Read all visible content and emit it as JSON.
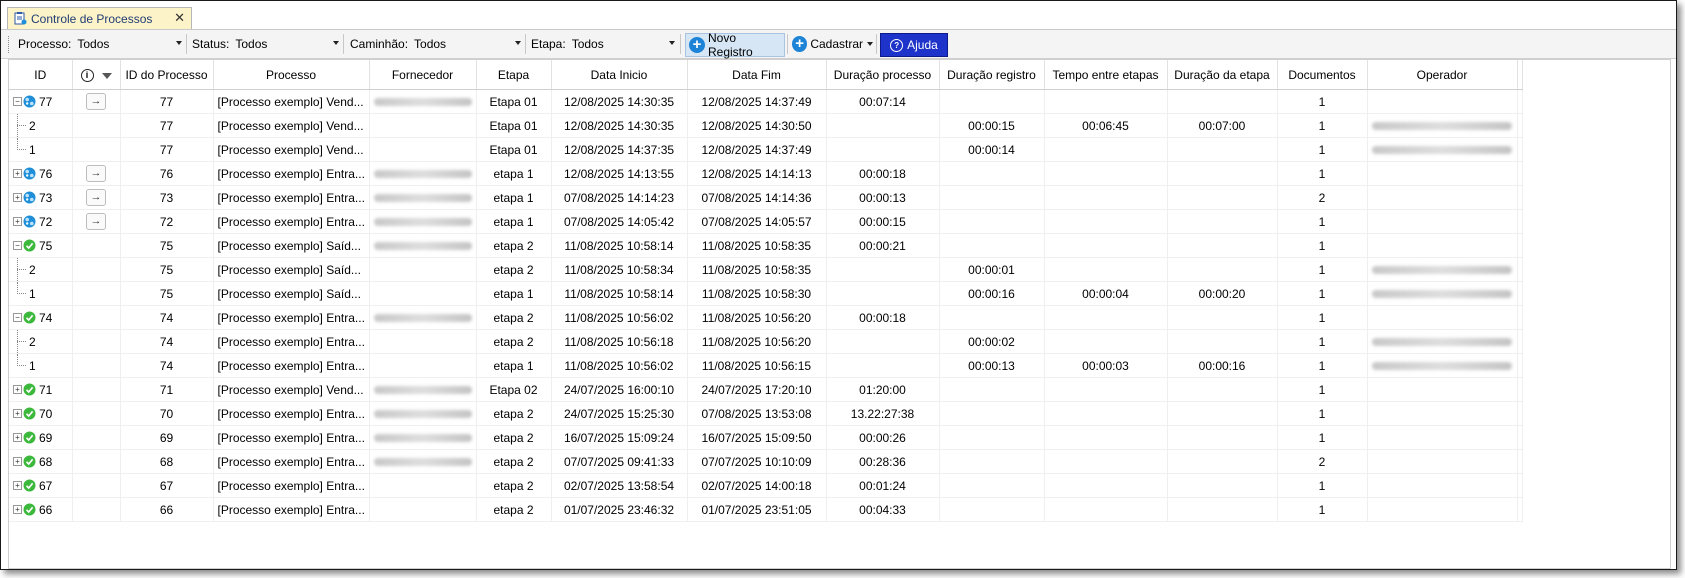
{
  "tab": {
    "label": "Controle de Processos",
    "close": "✕"
  },
  "toolbar": {
    "processo_label": "Processo:",
    "processo_value": "Todos",
    "status_label": "Status:",
    "status_value": "Todos",
    "caminhao_label": "Caminhão:",
    "caminhao_value": "Todos",
    "etapa_label": "Etapa:",
    "etapa_value": "Todos",
    "novo_label": "Novo Registro",
    "cadastrar_label": "Cadastrar",
    "ajuda_label": "Ajuda"
  },
  "columns": {
    "id": "ID",
    "id_processo": "ID do Processo",
    "processo": "Processo",
    "fornecedor": "Fornecedor",
    "etapa": "Etapa",
    "data_inicio": "Data Inicio",
    "data_fim": "Data Fim",
    "duracao_processo": "Duração processo",
    "duracao_registro": "Duração registro",
    "tempo_entre_etapas": "Tempo entre etapas",
    "duracao_etapa": "Duração da etapa",
    "documentos": "Documentos",
    "operador": "Operador"
  },
  "rows": [
    {
      "kind": "parent",
      "expanded": true,
      "status": "progress",
      "id": "77",
      "id_processo": "77",
      "processo": "[Processo exemplo] Vend...",
      "fornecedor_blur": true,
      "etapa": "Etapa 01",
      "data_inicio": "12/08/2025 14:30:35",
      "data_fim": "12/08/2025 14:37:49",
      "duracao_processo": "00:07:14",
      "duracao_registro": "",
      "tempo_entre_etapas": "",
      "duracao_etapa": "",
      "documentos": "1",
      "operador_blur": false,
      "arrow": true
    },
    {
      "kind": "child",
      "last": false,
      "id": "2",
      "id_processo": "77",
      "processo": "[Processo exemplo] Vend...",
      "fornecedor_blur": false,
      "etapa": "Etapa 01",
      "data_inicio": "12/08/2025 14:30:35",
      "data_fim": "12/08/2025 14:30:50",
      "duracao_processo": "",
      "duracao_registro": "00:00:15",
      "tempo_entre_etapas": "00:06:45",
      "duracao_etapa": "00:07:00",
      "documentos": "1",
      "operador_blur": true
    },
    {
      "kind": "child",
      "last": true,
      "id": "1",
      "id_processo": "77",
      "processo": "[Processo exemplo] Vend...",
      "fornecedor_blur": false,
      "etapa": "Etapa 01",
      "data_inicio": "12/08/2025 14:37:35",
      "data_fim": "12/08/2025 14:37:49",
      "duracao_processo": "",
      "duracao_registro": "00:00:14",
      "tempo_entre_etapas": "",
      "duracao_etapa": "",
      "documentos": "1",
      "operador_blur": true
    },
    {
      "kind": "parent",
      "expanded": false,
      "status": "progress",
      "id": "76",
      "id_processo": "76",
      "processo": "[Processo exemplo] Entra...",
      "fornecedor_blur": true,
      "etapa": "etapa 1",
      "data_inicio": "12/08/2025 14:13:55",
      "data_fim": "12/08/2025 14:14:13",
      "duracao_processo": "00:00:18",
      "duracao_registro": "",
      "tempo_entre_etapas": "",
      "duracao_etapa": "",
      "documentos": "1",
      "operador_blur": false,
      "arrow": true
    },
    {
      "kind": "parent",
      "expanded": false,
      "status": "progress",
      "id": "73",
      "id_processo": "73",
      "processo": "[Processo exemplo] Entra...",
      "fornecedor_blur": true,
      "etapa": "etapa 1",
      "data_inicio": "07/08/2025 14:14:23",
      "data_fim": "07/08/2025 14:14:36",
      "duracao_processo": "00:00:13",
      "duracao_registro": "",
      "tempo_entre_etapas": "",
      "duracao_etapa": "",
      "documentos": "2",
      "operador_blur": false,
      "arrow": true
    },
    {
      "kind": "parent",
      "expanded": false,
      "status": "progress",
      "id": "72",
      "id_processo": "72",
      "processo": "[Processo exemplo] Entra...",
      "fornecedor_blur": true,
      "etapa": "etapa 1",
      "data_inicio": "07/08/2025 14:05:42",
      "data_fim": "07/08/2025 14:05:57",
      "duracao_processo": "00:00:15",
      "duracao_registro": "",
      "tempo_entre_etapas": "",
      "duracao_etapa": "",
      "documentos": "1",
      "operador_blur": false,
      "arrow": true
    },
    {
      "kind": "parent",
      "expanded": true,
      "status": "done",
      "id": "75",
      "id_processo": "75",
      "processo": "[Processo exemplo] Saíd...",
      "fornecedor_blur": true,
      "etapa": "etapa 2",
      "data_inicio": "11/08/2025 10:58:14",
      "data_fim": "11/08/2025 10:58:35",
      "duracao_processo": "00:00:21",
      "duracao_registro": "",
      "tempo_entre_etapas": "",
      "duracao_etapa": "",
      "documentos": "1",
      "operador_blur": false,
      "arrow": false
    },
    {
      "kind": "child",
      "last": false,
      "id": "2",
      "id_processo": "75",
      "processo": "[Processo exemplo] Saíd...",
      "fornecedor_blur": false,
      "etapa": "etapa 2",
      "data_inicio": "11/08/2025 10:58:34",
      "data_fim": "11/08/2025 10:58:35",
      "duracao_processo": "",
      "duracao_registro": "00:00:01",
      "tempo_entre_etapas": "",
      "duracao_etapa": "",
      "documentos": "1",
      "operador_blur": true
    },
    {
      "kind": "child",
      "last": true,
      "id": "1",
      "id_processo": "75",
      "processo": "[Processo exemplo] Saíd...",
      "fornecedor_blur": false,
      "etapa": "etapa 1",
      "data_inicio": "11/08/2025 10:58:14",
      "data_fim": "11/08/2025 10:58:30",
      "duracao_processo": "",
      "duracao_registro": "00:00:16",
      "tempo_entre_etapas": "00:00:04",
      "duracao_etapa": "00:00:20",
      "documentos": "1",
      "operador_blur": true
    },
    {
      "kind": "parent",
      "expanded": true,
      "status": "done",
      "id": "74",
      "id_processo": "74",
      "processo": "[Processo exemplo] Entra...",
      "fornecedor_blur": true,
      "etapa": "etapa 2",
      "data_inicio": "11/08/2025 10:56:02",
      "data_fim": "11/08/2025 10:56:20",
      "duracao_processo": "00:00:18",
      "duracao_registro": "",
      "tempo_entre_etapas": "",
      "duracao_etapa": "",
      "documentos": "1",
      "operador_blur": false,
      "arrow": false
    },
    {
      "kind": "child",
      "last": false,
      "id": "2",
      "id_processo": "74",
      "processo": "[Processo exemplo] Entra...",
      "fornecedor_blur": false,
      "etapa": "etapa 2",
      "data_inicio": "11/08/2025 10:56:18",
      "data_fim": "11/08/2025 10:56:20",
      "duracao_processo": "",
      "duracao_registro": "00:00:02",
      "tempo_entre_etapas": "",
      "duracao_etapa": "",
      "documentos": "1",
      "operador_blur": true
    },
    {
      "kind": "child",
      "last": true,
      "id": "1",
      "id_processo": "74",
      "processo": "[Processo exemplo] Entra...",
      "fornecedor_blur": false,
      "etapa": "etapa 1",
      "data_inicio": "11/08/2025 10:56:02",
      "data_fim": "11/08/2025 10:56:15",
      "duracao_processo": "",
      "duracao_registro": "00:00:13",
      "tempo_entre_etapas": "00:00:03",
      "duracao_etapa": "00:00:16",
      "documentos": "1",
      "operador_blur": true
    },
    {
      "kind": "parent",
      "expanded": false,
      "status": "done",
      "id": "71",
      "id_processo": "71",
      "processo": "[Processo exemplo] Vend...",
      "fornecedor_blur": true,
      "etapa": "Etapa 02",
      "data_inicio": "24/07/2025 16:00:10",
      "data_fim": "24/07/2025 17:20:10",
      "duracao_processo": "01:20:00",
      "duracao_registro": "",
      "tempo_entre_etapas": "",
      "duracao_etapa": "",
      "documentos": "1",
      "operador_blur": false,
      "arrow": false
    },
    {
      "kind": "parent",
      "expanded": false,
      "status": "done",
      "id": "70",
      "id_processo": "70",
      "processo": "[Processo exemplo] Entra...",
      "fornecedor_blur": true,
      "etapa": "etapa 2",
      "data_inicio": "24/07/2025 15:25:30",
      "data_fim": "07/08/2025 13:53:08",
      "duracao_processo": "13.22:27:38",
      "duracao_registro": "",
      "tempo_entre_etapas": "",
      "duracao_etapa": "",
      "documentos": "1",
      "operador_blur": false,
      "arrow": false
    },
    {
      "kind": "parent",
      "expanded": false,
      "status": "done",
      "id": "69",
      "id_processo": "69",
      "processo": "[Processo exemplo] Entra...",
      "fornecedor_blur": true,
      "etapa": "etapa 2",
      "data_inicio": "16/07/2025 15:09:24",
      "data_fim": "16/07/2025 15:09:50",
      "duracao_processo": "00:00:26",
      "duracao_registro": "",
      "tempo_entre_etapas": "",
      "duracao_etapa": "",
      "documentos": "1",
      "operador_blur": false,
      "arrow": false
    },
    {
      "kind": "parent",
      "expanded": false,
      "status": "done",
      "id": "68",
      "id_processo": "68",
      "processo": "[Processo exemplo] Entra...",
      "fornecedor_blur": true,
      "etapa": "etapa 2",
      "data_inicio": "07/07/2025 09:41:33",
      "data_fim": "07/07/2025 10:10:09",
      "duracao_processo": "00:28:36",
      "duracao_registro": "",
      "tempo_entre_etapas": "",
      "duracao_etapa": "",
      "documentos": "2",
      "operador_blur": false,
      "arrow": false
    },
    {
      "kind": "parent",
      "expanded": false,
      "status": "done",
      "id": "67",
      "id_processo": "67",
      "processo": "[Processo exemplo] Entra...",
      "fornecedor_blur": false,
      "etapa": "etapa 2",
      "data_inicio": "02/07/2025 13:58:54",
      "data_fim": "02/07/2025 14:00:18",
      "duracao_processo": "00:01:24",
      "duracao_registro": "",
      "tempo_entre_etapas": "",
      "duracao_etapa": "",
      "documentos": "1",
      "operador_blur": false,
      "arrow": false
    },
    {
      "kind": "parent",
      "expanded": false,
      "status": "done",
      "id": "66",
      "id_processo": "66",
      "processo": "[Processo exemplo] Entra...",
      "fornecedor_blur": false,
      "etapa": "etapa 2",
      "data_inicio": "01/07/2025 23:46:32",
      "data_fim": "01/07/2025 23:51:05",
      "duracao_processo": "00:04:33",
      "duracao_registro": "",
      "tempo_entre_etapas": "",
      "duracao_etapa": "",
      "documentos": "1",
      "operador_blur": false,
      "arrow": false
    }
  ],
  "colors": {
    "progress": "#1e8fd8",
    "done": "#3cb83c",
    "accent": "#1e33c9"
  }
}
